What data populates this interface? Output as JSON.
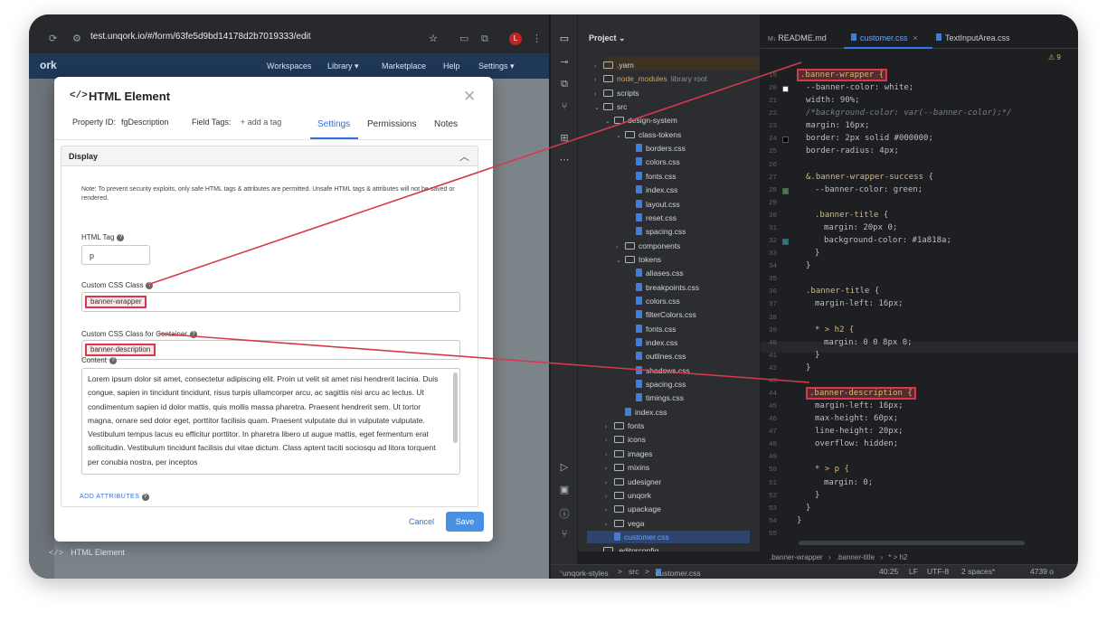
{
  "browser": {
    "url": "test.unqork.io/#/form/63fe5d9bd14178d2b7019333/edit",
    "avatar_letter": "L",
    "app_logo": "ork",
    "nav": [
      "Workspaces",
      "Library ▾",
      "Marketplace",
      "Help",
      "Settings ▾"
    ],
    "bottom_item": {
      "icon": "</>",
      "label": "HTML Element"
    }
  },
  "modal": {
    "icon": "</>",
    "title": "HTML Element",
    "property_id_label": "Property ID:",
    "property_id_value": "fgDescription",
    "field_tags_label": "Field Tags:",
    "add_tag": "+ add a tag",
    "tabs": [
      "Settings",
      "Permissions",
      "Notes"
    ],
    "active_tab": "Settings",
    "section_title": "Display",
    "note": "Note: To prevent security exploits, only safe HTML tags & attributes are permitted. Unsafe HTML tags & attributes will not be saved or rendered.",
    "html_tag_label": "HTML Tag",
    "html_tag_value": "p",
    "css_class_label": "Custom CSS Class",
    "css_class_value": "banner-wrapper",
    "container_class_label": "Custom CSS Class for Container",
    "container_class_value": "banner-description",
    "content_label": "Content",
    "content_value": "Lorem ipsum dolor sit amet, consectetur adipiscing elit. Proin ut velit sit amet nisi hendrerit lacinia. Duis congue, sapien in tincidunt tincidunt, risus turpis ullamcorper arcu, ac sagittis nisi arcu ac lectus. Ut condimentum sapien id dolor mattis, quis mollis massa pharetra. Praesent hendrerit sem. Ut tortor magna, ornare sed dolor eget, porttitor facilisis quam. Praesent vulputate dui in vulputate vulputate. Vestibulum tempus lacus eu efficitur porttitor. In pharetra libero ut augue mattis, eget fermentum erat sollicitudin. Vestibulum tincidunt facilisis dui vitae dictum. Class aptent taciti sociosqu ad litora torquent per conubia nostra, per inceptos",
    "add_attributes": "ADD ATTRIBUTES",
    "cancel": "Cancel",
    "save": "Save"
  },
  "ide": {
    "project_label": "Project ⌄",
    "tabs": [
      "README.md",
      "customer.css",
      "TextInputArea.css"
    ],
    "active_tab": "customer.css",
    "warnings": "⚠ 9",
    "tree": [
      {
        "name": ".yarn",
        "depth": 1,
        "kind": "folder",
        "open": false
      },
      {
        "name": "node_modules",
        "depth": 1,
        "kind": "folder",
        "open": false,
        "extra": "library root",
        "highlight": true
      },
      {
        "name": "scripts",
        "depth": 1,
        "kind": "folder",
        "open": false
      },
      {
        "name": "src",
        "depth": 1,
        "kind": "folder",
        "open": true
      },
      {
        "name": "design-system",
        "depth": 2,
        "kind": "folder",
        "open": true
      },
      {
        "name": "class-tokens",
        "depth": 3,
        "kind": "folder",
        "open": true
      },
      {
        "name": "borders.css",
        "depth": 4,
        "kind": "css"
      },
      {
        "name": "colors.css",
        "depth": 4,
        "kind": "css"
      },
      {
        "name": "fonts.css",
        "depth": 4,
        "kind": "css"
      },
      {
        "name": "index.css",
        "depth": 4,
        "kind": "css"
      },
      {
        "name": "layout.css",
        "depth": 4,
        "kind": "css"
      },
      {
        "name": "reset.css",
        "depth": 4,
        "kind": "css"
      },
      {
        "name": "spacing.css",
        "depth": 4,
        "kind": "css"
      },
      {
        "name": "components",
        "depth": 3,
        "kind": "folder",
        "open": false
      },
      {
        "name": "tokens",
        "depth": 3,
        "kind": "folder",
        "open": true
      },
      {
        "name": "aliases.css",
        "depth": 4,
        "kind": "css"
      },
      {
        "name": "breakpoints.css",
        "depth": 4,
        "kind": "css"
      },
      {
        "name": "colors.css",
        "depth": 4,
        "kind": "css"
      },
      {
        "name": "filterColors.css",
        "depth": 4,
        "kind": "css"
      },
      {
        "name": "fonts.css",
        "depth": 4,
        "kind": "css"
      },
      {
        "name": "index.css",
        "depth": 4,
        "kind": "css"
      },
      {
        "name": "outlines.css",
        "depth": 4,
        "kind": "css"
      },
      {
        "name": "shadows.css",
        "depth": 4,
        "kind": "css"
      },
      {
        "name": "spacing.css",
        "depth": 4,
        "kind": "css"
      },
      {
        "name": "timings.css",
        "depth": 4,
        "kind": "css"
      },
      {
        "name": "index.css",
        "depth": 3,
        "kind": "css"
      },
      {
        "name": "fonts",
        "depth": 2,
        "kind": "folder",
        "open": false
      },
      {
        "name": "icons",
        "depth": 2,
        "kind": "folder",
        "open": false
      },
      {
        "name": "images",
        "depth": 2,
        "kind": "folder",
        "open": false
      },
      {
        "name": "mixins",
        "depth": 2,
        "kind": "folder",
        "open": false
      },
      {
        "name": "udesigner",
        "depth": 2,
        "kind": "folder",
        "open": false
      },
      {
        "name": "unqork",
        "depth": 2,
        "kind": "folder",
        "open": false
      },
      {
        "name": "upackage",
        "depth": 2,
        "kind": "folder",
        "open": false
      },
      {
        "name": "vega",
        "depth": 2,
        "kind": "folder",
        "open": false
      },
      {
        "name": "customer.css",
        "depth": 2,
        "kind": "css",
        "selected": true
      },
      {
        "name": ".editorconfig",
        "depth": 1,
        "kind": "file"
      }
    ],
    "code_lines": [
      {
        "n": "19",
        "text": ".banner-wrapper {",
        "cls": "k",
        "indent": 0,
        "hl": true
      },
      {
        "n": "20",
        "text": "--banner-color: white;",
        "cls": "p",
        "indent": 1,
        "swatch": "#ffffff"
      },
      {
        "n": "21",
        "text": "width: 90%;",
        "cls": "p",
        "indent": 1
      },
      {
        "n": "22",
        "text": "/*background-color: var(--banner-color);*/",
        "cls": "cm",
        "indent": 1
      },
      {
        "n": "23",
        "text": "margin: 16px;",
        "cls": "p",
        "indent": 1
      },
      {
        "n": "24",
        "text": "border: 2px solid #000000;",
        "cls": "p",
        "indent": 1,
        "swatch": "#000000"
      },
      {
        "n": "25",
        "text": "border-radius: 4px;",
        "cls": "p",
        "indent": 1
      },
      {
        "n": "26",
        "text": "",
        "cls": "p",
        "indent": 0
      },
      {
        "n": "27",
        "text": "&.banner-wrapper-success {",
        "cls": "k",
        "indent": 1
      },
      {
        "n": "28",
        "text": "--banner-color: green;",
        "cls": "p",
        "indent": 2,
        "swatch": "#2e8b3a"
      },
      {
        "n": "29",
        "text": "",
        "cls": "p",
        "indent": 0
      },
      {
        "n": "30",
        "text": ".banner-title {",
        "cls": "k",
        "indent": 2
      },
      {
        "n": "31",
        "text": "margin: 20px 0;",
        "cls": "p",
        "indent": 3
      },
      {
        "n": "32",
        "text": "background-color: #1a818a;",
        "cls": "p",
        "indent": 3,
        "swatch": "#1a818a"
      },
      {
        "n": "33",
        "text": "}",
        "cls": "p",
        "indent": 2
      },
      {
        "n": "34",
        "text": "}",
        "cls": "p",
        "indent": 1
      },
      {
        "n": "35",
        "text": "",
        "cls": "p",
        "indent": 0
      },
      {
        "n": "36",
        "text": ".banner-title {",
        "cls": "k",
        "indent": 1
      },
      {
        "n": "37",
        "text": "margin-left: 16px;",
        "cls": "p",
        "indent": 2
      },
      {
        "n": "38",
        "text": "",
        "cls": "p",
        "indent": 0
      },
      {
        "n": "39",
        "text": "* > h2 {",
        "cls": "k",
        "indent": 2
      },
      {
        "n": "40",
        "text": "margin: 0 0 8px 0;",
        "cls": "p",
        "indent": 3
      },
      {
        "n": "41",
        "text": "}",
        "cls": "p",
        "indent": 2
      },
      {
        "n": "42",
        "text": "}",
        "cls": "p",
        "indent": 1
      },
      {
        "n": "43",
        "text": "",
        "cls": "p",
        "indent": 0
      },
      {
        "n": "44",
        "text": ".banner-description {",
        "cls": "k",
        "indent": 1,
        "hl": true
      },
      {
        "n": "45",
        "text": "margin-left: 16px;",
        "cls": "p",
        "indent": 2
      },
      {
        "n": "46",
        "text": "max-height: 60px;",
        "cls": "p",
        "indent": 2
      },
      {
        "n": "47",
        "text": "line-height: 20px;",
        "cls": "p",
        "indent": 2
      },
      {
        "n": "48",
        "text": "overflow: hidden;",
        "cls": "p",
        "indent": 2
      },
      {
        "n": "49",
        "text": "",
        "cls": "p",
        "indent": 0
      },
      {
        "n": "50",
        "text": "* > p {",
        "cls": "k",
        "indent": 2
      },
      {
        "n": "51",
        "text": "margin: 0;",
        "cls": "p",
        "indent": 3
      },
      {
        "n": "52",
        "text": "}",
        "cls": "p",
        "indent": 2
      },
      {
        "n": "53",
        "text": "}",
        "cls": "p",
        "indent": 1
      },
      {
        "n": "54",
        "text": "}",
        "cls": "p",
        "indent": 0
      },
      {
        "n": "55",
        "text": "",
        "cls": "p",
        "indent": 0
      }
    ],
    "breadcrumb": [
      ".banner-wrapper",
      ".banner-title",
      "* > h2"
    ],
    "status": {
      "project": "unqork-styles",
      "path_sep": ">",
      "folder": "src",
      "file": "customer.css",
      "position": "40:25",
      "line_ending": "LF",
      "encoding": "UTF-8",
      "indent": "2 spaces*",
      "extra": "4739 o"
    }
  },
  "colors": {
    "highlight": "#d43a4a",
    "accent": "#2f6fdb",
    "ide_bg": "#1e1f22",
    "nav_bg": "#1f3857"
  }
}
